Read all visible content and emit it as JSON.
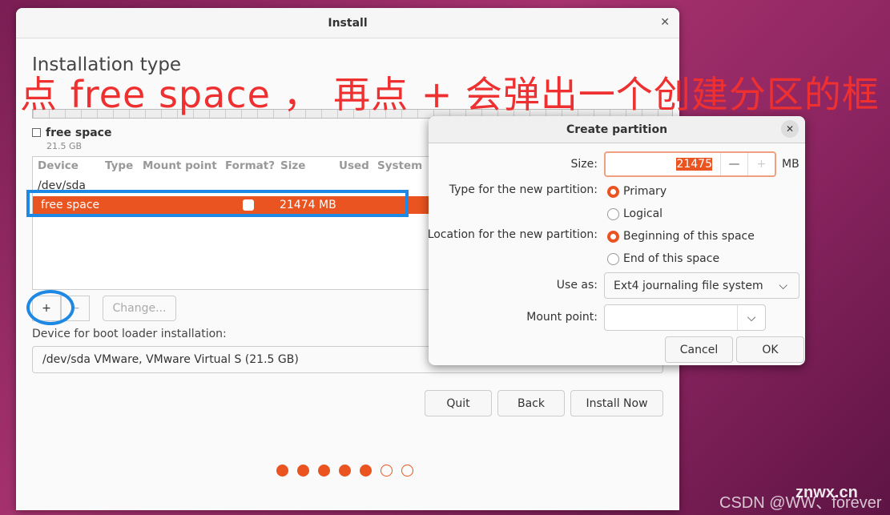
{
  "window": {
    "title": "Install",
    "heading": "Installation type"
  },
  "annotation": "点 free space ， 再点 + 会弹出一个创建分区的框",
  "legend": {
    "label": "free space",
    "size": "21.5 GB"
  },
  "table": {
    "columns": [
      "Device",
      "Type",
      "Mount point",
      "Format?",
      "Size",
      "Used",
      "System"
    ],
    "rows": [
      {
        "device": "/dev/sda"
      },
      {
        "device": "free space",
        "format": false,
        "size": "21474 MB",
        "selected": true
      }
    ]
  },
  "buttons": {
    "add": "+",
    "remove": "−",
    "change": "Change...",
    "quit": "Quit",
    "back": "Back",
    "install": "Install Now"
  },
  "boot": {
    "label": "Device for boot loader installation:",
    "value": "/dev/sda VMware, VMware Virtual S (21.5 GB)"
  },
  "progress": {
    "steps_total": 7,
    "steps_done": 5
  },
  "dialog": {
    "title": "Create partition",
    "size_label": "Size:",
    "size_value": "21475",
    "size_unit": "MB",
    "minus": "—",
    "plus": "+",
    "type_label": "Type for the new partition:",
    "type_options": [
      "Primary",
      "Logical"
    ],
    "type_selected": "Primary",
    "location_label": "Location for the new partition:",
    "location_options": [
      "Beginning of this space",
      "End of this space"
    ],
    "location_selected": "Beginning of this space",
    "use_as_label": "Use as:",
    "use_as_value": "Ext4 journaling file system",
    "mount_label": "Mount point:",
    "mount_value": "",
    "cancel": "Cancel",
    "ok": "OK"
  },
  "watermarks": [
    "CSDN @WW、forever",
    "znwx.cn"
  ],
  "colors": {
    "accent": "#e95420",
    "highlight": "#1e88e5",
    "annotation": "#ee3030"
  }
}
